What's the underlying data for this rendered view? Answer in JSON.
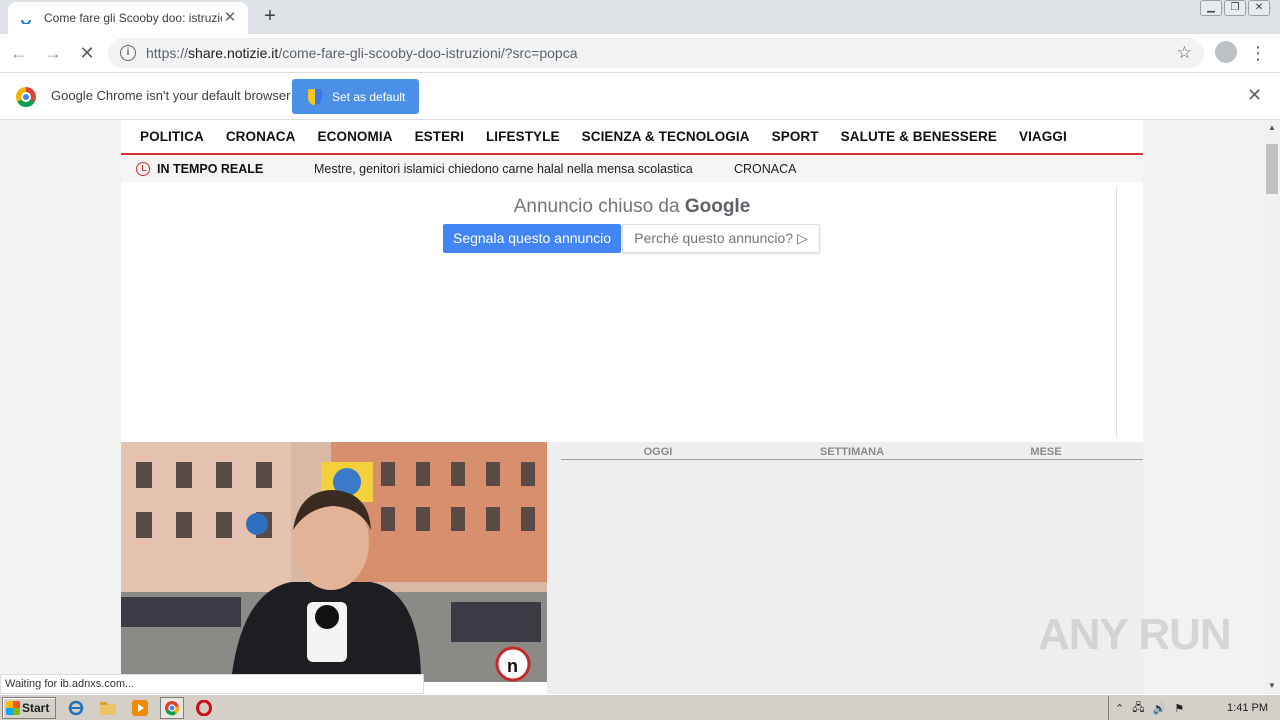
{
  "browser": {
    "tab_title": "Come fare gli Scooby doo: istruzioni",
    "url_prefix": "https://",
    "url_host": "share.notizie.it",
    "url_path": "/come-fare-gli-scooby-doo-istruzioni/?src=popca"
  },
  "infobar": {
    "message": "Google Chrome isn't your default browser",
    "button_label": "Set as default"
  },
  "site": {
    "nav": [
      "POLITICA",
      "CRONACA",
      "ECONOMIA",
      "ESTERI",
      "LIFESTYLE",
      "SCIENZA & TECNOLOGIA",
      "SPORT",
      "SALUTE & BENESSERE",
      "VIAGGI"
    ],
    "accent_color": "#d32f2f",
    "ticker": {
      "label": "IN TEMPO REALE",
      "headline": "Mestre, genitori islamici chiedono carne halal nella mensa scolastica",
      "category": "CRONACA"
    },
    "ad": {
      "closed_text": "Annuncio chiuso da",
      "closed_brand": "Google",
      "report_button": "Segnala questo annuncio",
      "why_button": "Perché questo annuncio? ▷"
    },
    "popular_tabs": [
      "OGGI",
      "SETTIMANA",
      "MESE"
    ]
  },
  "status_text": "Waiting for ib.adnxs.com...",
  "watermark": "ANY RUN",
  "taskbar": {
    "start_label": "Start",
    "clock": "1:41 PM"
  }
}
